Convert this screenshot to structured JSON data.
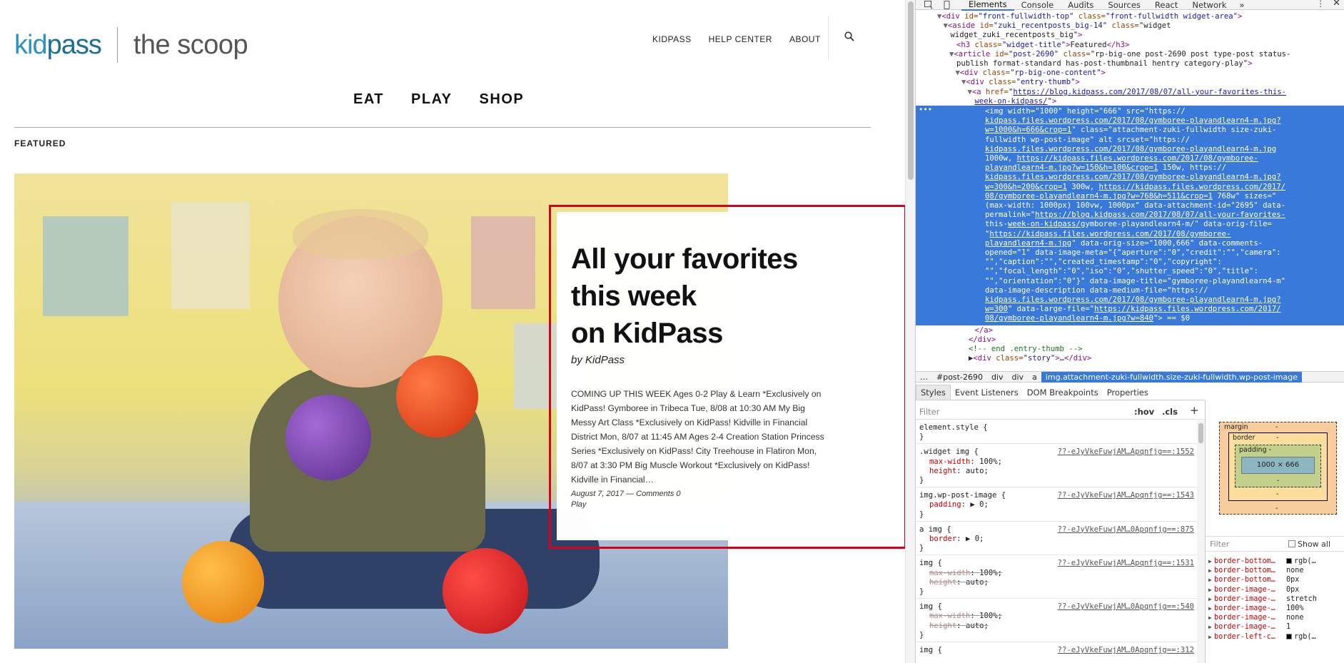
{
  "site": {
    "logo_kid": "kid",
    "logo_pass": "pass",
    "logo_scoop": "the scoop",
    "top_nav": [
      "KIDPASS",
      "HELP CENTER",
      "ABOUT"
    ],
    "category_nav": [
      "EAT",
      "PLAY",
      "SHOP"
    ],
    "section_label": "FEATURED"
  },
  "story": {
    "title_lines": [
      "All your favorites",
      "this week",
      "on KidPass"
    ],
    "author": "by KidPass",
    "excerpt": "COMING UP THIS WEEK Ages 0-2 Play & Learn *Exclusively on KidPass! Gymboree in Tribeca Tue, 8/08 at 10:30 AM My Big Messy Art Class *Exclusively on KidPass! Kidville in Financial District Mon, 8/07 at 11:45 AM Ages 2-4 Creation Station Princess Series *Exclusively on KidPass! City Treehouse in Flatiron Mon, 8/07 at 3:30 PM Big Muscle Workout *Exclusively on KidPass! Kidville in Financial…",
    "date": "August 7, 2017",
    "dash": "—",
    "comments": "Comments 0",
    "category": "Play"
  },
  "devtools": {
    "tabs": [
      "Elements",
      "Console",
      "Audits",
      "Sources",
      "React",
      "Network"
    ],
    "active_tab": "Elements",
    "more_tabs": "»",
    "menu_dots": "⋮",
    "close": "✕",
    "dom_lines": [
      {
        "indent": 4,
        "arrow": "▼",
        "html": "<div id=\"front-fullwidth-top\" class=\"front-fullwidth widget-area\">"
      },
      {
        "indent": 5,
        "arrow": "▼",
        "html": "<aside id=\"zuki_recentposts_big-14\" class=\"widget"
      },
      {
        "indent": 5,
        "arrow": "",
        "html": "widget_zuki_recentposts_big\">"
      },
      {
        "indent": 6,
        "arrow": "",
        "html": "<h3 class=\"widget-title\">Featured</h3>"
      },
      {
        "indent": 6,
        "arrow": "▼",
        "html": "<article id=\"post-2690\" class=\"rp-big-one post-2690 post type-post status-"
      },
      {
        "indent": 6,
        "arrow": "",
        "html": "publish format-standard has-post-thumbnail hentry category-play\">"
      },
      {
        "indent": 7,
        "arrow": "▼",
        "html": "<div class=\"rp-big-one-content\">"
      },
      {
        "indent": 8,
        "arrow": "▼",
        "html": "<div class=\"entry-thumb\">"
      },
      {
        "indent": 9,
        "arrow": "▼",
        "html": "<a href=\"https://blog.kidpass.com/2017/08/07/all-your-favorites-this-"
      },
      {
        "indent": 9,
        "arrow": "",
        "html": "week-on-kidpass/\">"
      }
    ],
    "selected_lines": [
      "<img width=\"1000\" height=\"666\" src=\"https://",
      "kidpass.files.wordpress.com/2017/08/gymboree-playandlearn4-m.jpg?",
      "w=1000&h=666&crop=1\" class=\"attachment-zuki-fullwidth size-zuki-",
      "fullwidth wp-post-image\" alt srcset=\"https://",
      "kidpass.files.wordpress.com/2017/08/gymboree-playandlearn4-m.jpg",
      "1000w, https://kidpass.files.wordpress.com/2017/08/gymboree-",
      "playandlearn4-m.jpg?w=150&h=100&crop=1 150w, https://",
      "kidpass.files.wordpress.com/2017/08/gymboree-playandlearn4-m.jpg?",
      "w=300&h=200&crop=1 300w, https://kidpass.files.wordpress.com/2017/",
      "08/gymboree-playandlearn4-m.jpg?w=768&h=511&crop=1 768w\" sizes=\"",
      "(max-width: 1000px) 100vw, 1000px\" data-attachment-id=\"2695\" data-",
      "permalink=\"https://blog.kidpass.com/2017/08/07/all-your-favorites-",
      "this-week-on-kidpass/gymboree-playandlearn4-m/\" data-orig-file=",
      "\"https://kidpass.files.wordpress.com/2017/08/gymboree-",
      "playandlearn4-m.jpg\" data-orig-size=\"1000,666\" data-comments-",
      "opened=\"1\" data-image-meta=\"{\"aperture\":\"0\",\"credit\":\"\",\"camera\":",
      "\"\",\"caption\":\"\",\"created_timestamp\":\"0\",\"copyright\":",
      "\"\",\"focal_length\":\"0\",\"iso\":\"0\",\"shutter_speed\":\"0\",\"title\":",
      "\"\",\"orientation\":\"0\"}\" data-image-title=\"gymboree-playandlearn4-m\"",
      "data-image-description data-medium-file=\"https://",
      "kidpass.files.wordpress.com/2017/08/gymboree-playandlearn4-m.jpg?",
      "w=300\" data-large-file=\"https://kidpass.files.wordpress.com/2017/",
      "08/gymboree-playandlearn4-m.jpg?w=840\"> == $0"
    ],
    "selected_ellipsis": "•••",
    "dom_after": [
      {
        "indent": 9,
        "html": "</a>"
      },
      {
        "indent": 8,
        "html": "</div>"
      },
      {
        "indent": 8,
        "html": "<!-- end .entry-thumb -->"
      },
      {
        "indent": 8,
        "html": "▶<div class=\"story\">…</div>"
      }
    ],
    "breadcrumbs": [
      "…",
      "#post-2690",
      "div",
      "div",
      "a"
    ],
    "breadcrumb_current": "img.attachment-zuki-fullwidth.size-zuki-fullwidth.wp-post-image",
    "subtabs": [
      "Styles",
      "Event Listeners",
      "DOM Breakpoints",
      "Properties"
    ],
    "styles_filter_placeholder": "Filter",
    "hov": ":hov",
    "cls": ".cls",
    "plus": "+",
    "rules": [
      {
        "selector": "element.style {",
        "source": "",
        "props": [],
        "close": "}"
      },
      {
        "selector": ".widget img {",
        "source": "??-eJyVkeFuwjAM…Apqnfjg==:1552",
        "props": [
          {
            "n": "max-width",
            "v": "100%;",
            "strike": false
          },
          {
            "n": "height",
            "v": "auto;",
            "strike": false
          }
        ],
        "close": "}"
      },
      {
        "selector": "img.wp-post-image {",
        "source": "??-eJyVkeFuwjAM…Apqnfjg==:1543",
        "props": [
          {
            "n": "padding",
            "v": "▶ 0;",
            "strike": false
          }
        ],
        "close": "}"
      },
      {
        "selector": "a img {",
        "source": "??-eJyVkeFuwjAM…0Apqnfjg==:875",
        "props": [
          {
            "n": "border",
            "v": "▶ 0;",
            "strike": false
          }
        ],
        "close": "}"
      },
      {
        "selector": "img {",
        "source": "??-eJyVkeFuwjAM…Apqnfjg==:1531",
        "props": [
          {
            "n": "max-width",
            "v": "100%;",
            "strike": true
          },
          {
            "n": "height",
            "v": "auto;",
            "strike": true
          }
        ],
        "close": "}"
      },
      {
        "selector": "img {",
        "source": "??-eJyVkeFuwjAM…0Apqnfjg==:540",
        "props": [
          {
            "n": "max-width",
            "v": "100%;",
            "strike": true
          },
          {
            "n": "height",
            "v": "auto;",
            "strike": true
          }
        ],
        "close": "}"
      },
      {
        "selector": "img {",
        "source": "??-eJyVkeFuwjAM…0Apqnfjg==:312",
        "props": [],
        "close": ""
      }
    ],
    "box_model": {
      "margin_label": "margin",
      "border_label": "border",
      "padding_label": "padding -",
      "content": "1000 × 666",
      "dash": "-"
    },
    "computed_filter_placeholder": "Filter",
    "show_all": "Show all",
    "computed": [
      {
        "n": "border-bottom…",
        "v": "rgb(…",
        "swatch": true
      },
      {
        "n": "border-bottom…",
        "v": "none",
        "swatch": false
      },
      {
        "n": "border-bottom…",
        "v": "0px",
        "swatch": false
      },
      {
        "n": "border-image-…",
        "v": "0px",
        "swatch": false
      },
      {
        "n": "border-image-…",
        "v": "stretch",
        "swatch": false
      },
      {
        "n": "border-image-…",
        "v": "100%",
        "swatch": false
      },
      {
        "n": "border-image-…",
        "v": "none",
        "swatch": false
      },
      {
        "n": "border-image-…",
        "v": "1",
        "swatch": false
      },
      {
        "n": "border-left-c…",
        "v": "rgb(…",
        "swatch": true
      }
    ]
  },
  "colors": {
    "brand_blue": "#2a93bf",
    "highlight_red": "#d9001b",
    "devtools_select": "#3879d9"
  }
}
